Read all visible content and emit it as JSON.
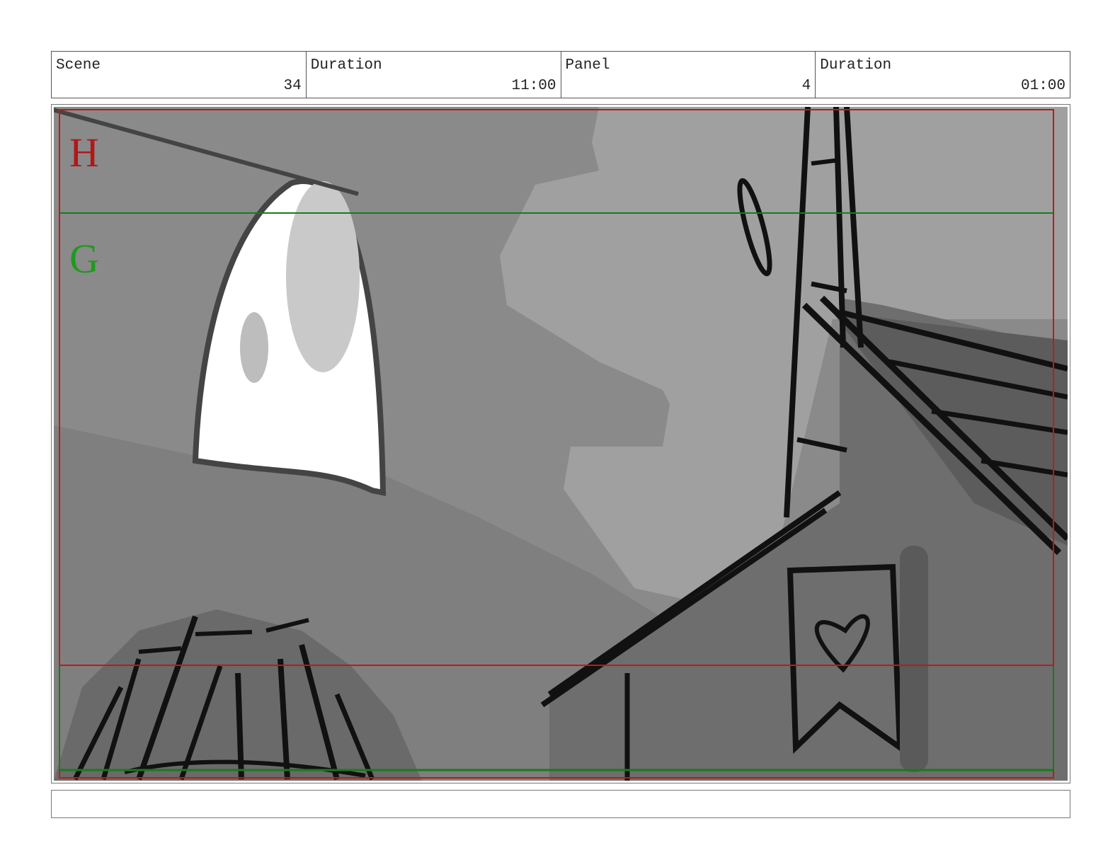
{
  "header": {
    "scene_label": "Scene",
    "scene_value": "34",
    "scene_duration_label": "Duration",
    "scene_duration_value": "11:00",
    "panel_label": "Panel",
    "panel_value": "4",
    "panel_duration_label": "Duration",
    "panel_duration_value": "01:00"
  },
  "panel": {
    "safe_area_labels": {
      "top": "H",
      "bottom": "G"
    },
    "colors": {
      "outer_frame": "#c01818",
      "title_safe": "#1a7a1a"
    }
  },
  "notes": {
    "text": ""
  }
}
